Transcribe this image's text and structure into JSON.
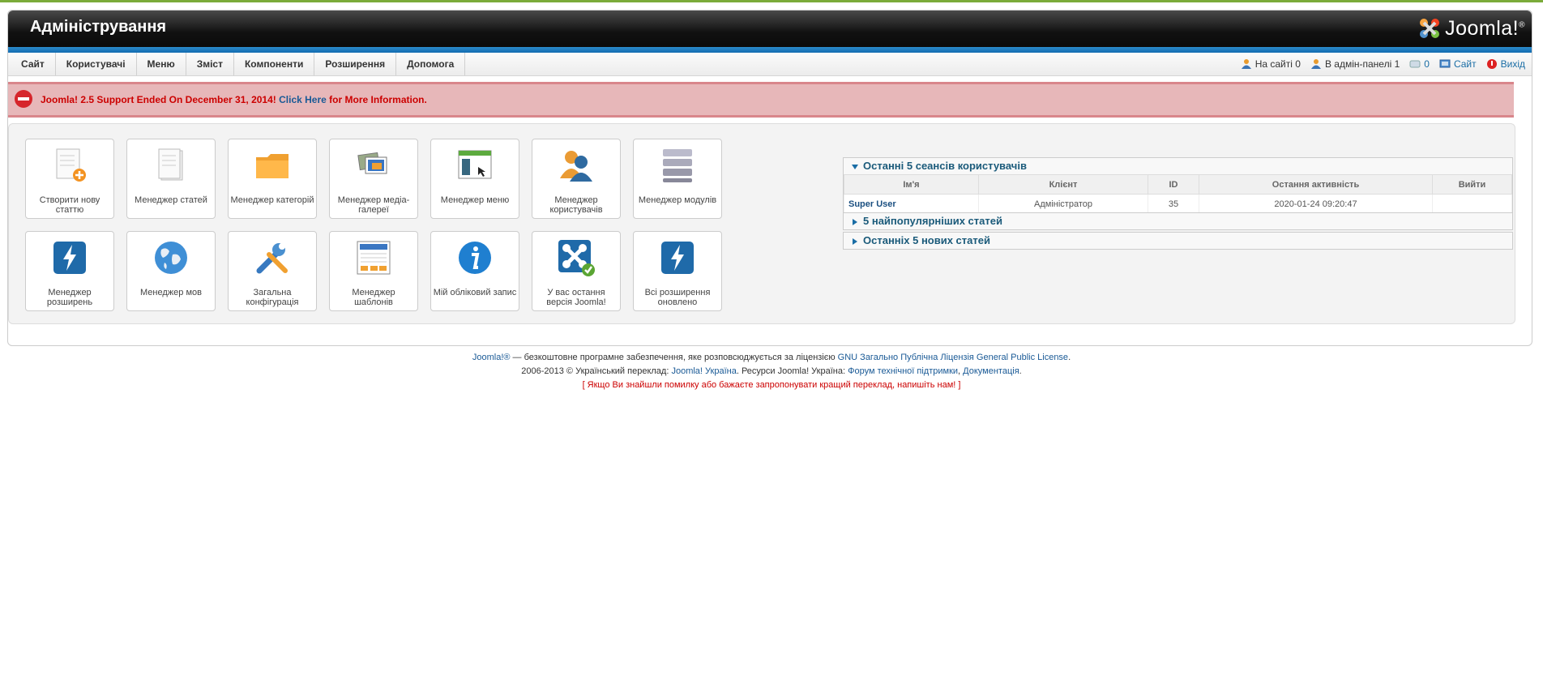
{
  "header": {
    "title": "Адміністрування",
    "logo_text": "Joomla!",
    "logo_mark": "®"
  },
  "menu": [
    "Сайт",
    "Користувачі",
    "Меню",
    "Зміст",
    "Компоненти",
    "Розширення",
    "Допомога"
  ],
  "status": {
    "on_site": "На сайті 0",
    "in_admin": "В адмін-панелі 1",
    "messages": "0",
    "site": "Сайт",
    "logout": "Вихід"
  },
  "alert": {
    "text_before": "Joomla! 2.5 Support Ended On December 31, 2014!",
    "link": "Click Here",
    "text_after": "for More Information."
  },
  "icons": [
    {
      "label": "Створити нову статтю",
      "icon": "add-article-icon"
    },
    {
      "label": "Менеджер статей",
      "icon": "article-icon"
    },
    {
      "label": "Менеджер категорій",
      "icon": "folder-icon"
    },
    {
      "label": "Менеджер медіа-галереї",
      "icon": "media-icon"
    },
    {
      "label": "Менеджер меню",
      "icon": "menu-icon"
    },
    {
      "label": "Менеджер користувачів",
      "icon": "users-icon"
    },
    {
      "label": "Менеджер модулів",
      "icon": "modules-icon"
    },
    {
      "label": "Менеджер розширень",
      "icon": "extension-icon"
    },
    {
      "label": "Менеджер мов",
      "icon": "globe-icon"
    },
    {
      "label": "Загальна конфігурація",
      "icon": "tools-icon"
    },
    {
      "label": "Менеджер шаблонів",
      "icon": "template-icon"
    },
    {
      "label": "Мій обліковий запис",
      "icon": "info-icon"
    },
    {
      "label": "У вас остання версія Joomla!",
      "icon": "joomla-update-icon"
    },
    {
      "label": "Всі розширення оновлено",
      "icon": "extension-update-icon"
    }
  ],
  "panels": {
    "sessions": {
      "title": "Останні 5 сеансів користувачів",
      "columns": [
        "Ім'я",
        "Клієнт",
        "ID",
        "Остання активність",
        "Вийти"
      ],
      "rows": [
        [
          "Super User",
          "Адміністратор",
          "35",
          "2020-01-24 09:20:47",
          ""
        ]
      ]
    },
    "popular": {
      "title": "5 найпопулярніших статей"
    },
    "latest": {
      "title": "Останніх 5 нових статей"
    }
  },
  "footer": {
    "l1_link1": "Joomla!®",
    "l1_text": " — безкоштовне програмне забезпечення, яке розповсюджується за ліцензією ",
    "l1_link2": "GNU Загально Публічна Ліцензія General Public License",
    "l2_text1": "2006-2013 © Український переклад: ",
    "l2_link1": "Joomla! Україна",
    "l2_text2": ". Ресурси Joomla! Україна: ",
    "l2_link2": "Форум технічної підтримки",
    "l2_sep": ", ",
    "l2_link3": "Документація",
    "l3": "[ Якщо Ви знайшли помилку або бажаєте запропонувати кращий переклад, напишіть нам! ]"
  },
  "colors": {
    "accent": "#1a6da5",
    "alert_bg": "#e7b7b9",
    "alert_text": "#cc0000",
    "header_stripe": "#1b75bb"
  }
}
